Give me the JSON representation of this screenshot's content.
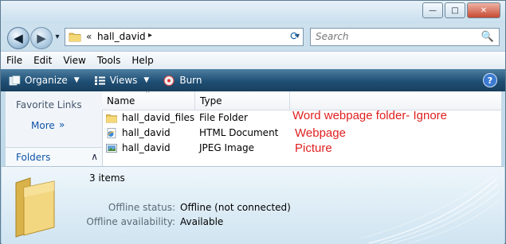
{
  "titlebar": {
    "title": "",
    "min_glyph": "—",
    "max_glyph": "□",
    "close_glyph": "✕"
  },
  "nav": {
    "back_glyph": "◀",
    "forward_glyph": "▶",
    "drop_glyph": "▾",
    "address": {
      "chevrons": "«",
      "folder": "hall_david",
      "separator": "▸",
      "drop_glyph": "▾"
    },
    "refresh_glyph": "⟳",
    "search": {
      "placeholder": "Search",
      "icon_glyph": "🔍"
    }
  },
  "menu": {
    "items": [
      "File",
      "Edit",
      "View",
      "Tools",
      "Help"
    ]
  },
  "toolbar": {
    "organize": "Organize",
    "views": "Views",
    "burn": "Burn",
    "arrow_glyph": "▼",
    "help_glyph": "?"
  },
  "navpane": {
    "favorite_links": "Favorite Links",
    "more": "More",
    "more_glyph": "»",
    "folders": "Folders",
    "folders_glyph": "∧"
  },
  "columns": {
    "name": "Name",
    "type": "Type",
    "sort_glyph": "^"
  },
  "files": [
    {
      "name": "hall_david_files",
      "type": "File Folder",
      "icon": "folder-icon",
      "annotation": "Word webpage folder- Ignore"
    },
    {
      "name": "hall_david",
      "type": "HTML Document",
      "icon": "html-document-icon",
      "annotation": "Webpage"
    },
    {
      "name": "hall_david",
      "type": "JPEG Image",
      "icon": "jpeg-image-icon",
      "annotation": "Picture"
    }
  ],
  "details": {
    "item_count": "3 items",
    "offline_status_label": "Offline status:",
    "offline_status_value": "Offline (not connected)",
    "offline_availability_label": "Offline availability:",
    "offline_availability_value": "Available"
  },
  "colors": {
    "toolbar": "#1f4f75",
    "link": "#0f52a6",
    "annotation": "#e02020"
  }
}
